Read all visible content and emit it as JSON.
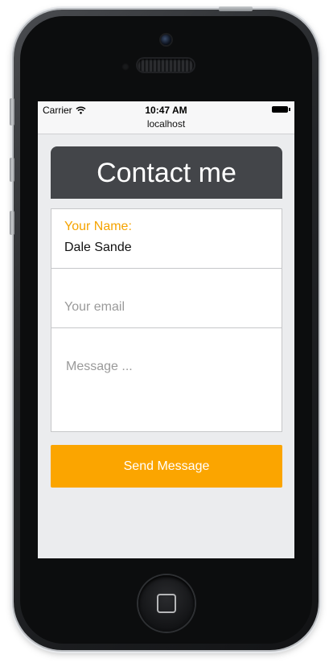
{
  "status_bar": {
    "carrier": "Carrier",
    "time": "10:47 AM"
  },
  "browser": {
    "url": "localhost"
  },
  "page": {
    "title": "Contact me"
  },
  "form": {
    "name_label": "Your Name:",
    "name_value": "Dale Sande",
    "email_placeholder": "Your email",
    "message_placeholder": "Message ...",
    "submit_label": "Send Message"
  },
  "colors": {
    "accent": "#fba500",
    "header_bg": "#434549",
    "label": "#f5a300"
  },
  "icons": {
    "wifi": "wifi-icon",
    "battery": "battery-icon",
    "home": "home-button"
  }
}
